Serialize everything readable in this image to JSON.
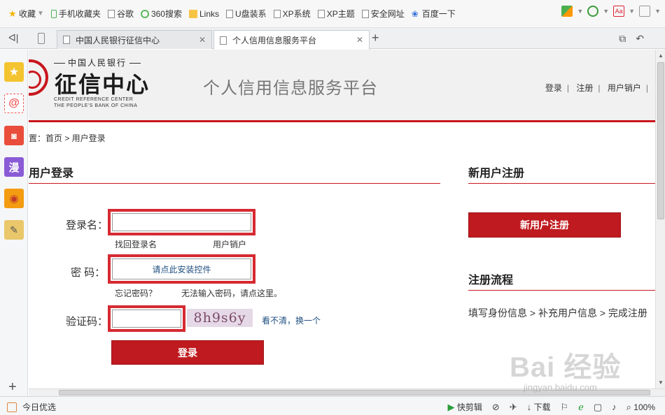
{
  "bookmarks": {
    "items": [
      {
        "label": "收藏",
        "icon": "star-icon"
      },
      {
        "label": "手机收藏夹",
        "icon": "phone-icon"
      },
      {
        "label": "谷歌",
        "icon": "page-icon"
      },
      {
        "label": "360搜索",
        "icon": "360-icon"
      },
      {
        "label": "Links",
        "icon": "folder-icon"
      },
      {
        "label": "U盘装系",
        "icon": "page-icon"
      },
      {
        "label": "XP系统",
        "icon": "page-icon"
      },
      {
        "label": "XP主题",
        "icon": "page-icon"
      },
      {
        "label": "安全网址",
        "icon": "page-icon"
      },
      {
        "label": "百度一下",
        "icon": "paw-icon"
      }
    ]
  },
  "tabs": [
    {
      "label": "中国人民银行征信中心",
      "active": false
    },
    {
      "label": "个人信用信息服务平台",
      "active": true
    }
  ],
  "page": {
    "logo": {
      "top": "中国人民银行",
      "main": "征信中心",
      "en_line1": "CREDIT REFERENCE CENTER",
      "en_line2": "THE PEOPLE'S BANK OF CHINA"
    },
    "platform_title": "个人信用信息服务平台",
    "header_links": {
      "login": "登录",
      "register": "注册",
      "cancel": "用户销户"
    },
    "breadcrumb": "位置：首页 > 用户登录",
    "login": {
      "title": "用户登录",
      "username_label": "登录名：",
      "find_username": "找回登录名",
      "cancel_account": "用户销户",
      "password_label": "密 码：",
      "install_control": "请点此安装控件",
      "forgot_password": "忘记密码？",
      "cannot_input": "无法输入密码，请点这里。",
      "captcha_label": "验证码：",
      "captcha_text": "8h9s6y",
      "captcha_refresh": "看不清，换一个",
      "login_button": "登录"
    },
    "register": {
      "title": "新用户注册",
      "button": "新用户注册",
      "flow_title": "注册流程",
      "steps": "填写身份信息 > 补充用户信息 > 完成注册"
    }
  },
  "status": {
    "left_label": "今日优选",
    "quick_cut": "快剪辑",
    "download": "下载",
    "zoom": "100%"
  },
  "watermark": {
    "text": "Bai 经验",
    "url": "jingyan.baidu.com"
  },
  "colors": {
    "brand_red": "#c8161d",
    "highlight_red": "#d62a32"
  }
}
